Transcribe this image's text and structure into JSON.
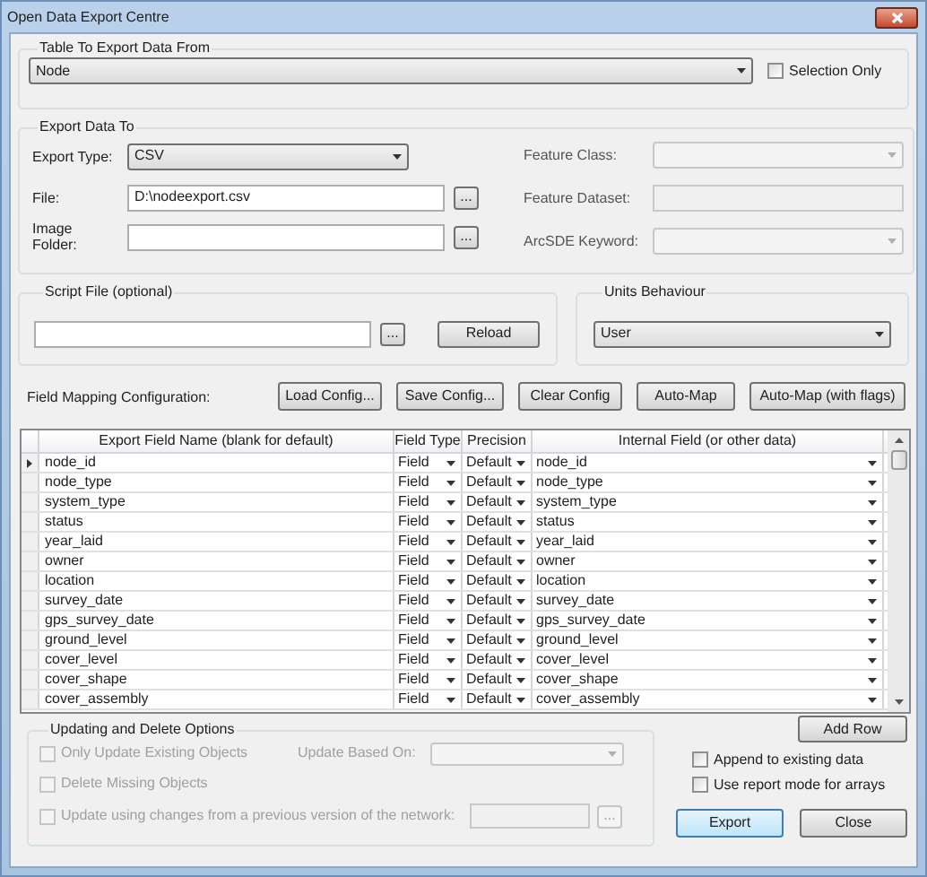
{
  "window": {
    "title": "Open Data Export Centre"
  },
  "source": {
    "legend": "Table To Export Data From",
    "table": "Node",
    "selection_only": {
      "label": "Selection Only",
      "checked": false
    }
  },
  "export_to": {
    "legend": "Export Data To",
    "export_type": {
      "label": "Export Type:",
      "value": "CSV"
    },
    "file": {
      "label": "File:",
      "value": "D:\\nodeexport.csv",
      "browse": "..."
    },
    "image_folder": {
      "label": "Image Folder:",
      "browse": "..."
    },
    "feature_class": {
      "label": "Feature Class:",
      "disabled": true
    },
    "feature_dataset": {
      "label": "Feature Dataset:",
      "disabled": true
    },
    "arcsde_keyword": {
      "label": "ArcSDE Keyword:",
      "disabled": true
    }
  },
  "script_file": {
    "legend": "Script File (optional)",
    "browse": "...",
    "reload": "Reload"
  },
  "units": {
    "legend": "Units Behaviour",
    "value": "User"
  },
  "mapping": {
    "label": "Field Mapping Configuration:",
    "buttons": [
      "Load Config...",
      "Save Config...",
      "Clear Config",
      "Auto-Map",
      "Auto-Map (with flags)"
    ]
  },
  "grid": {
    "columns": [
      "Export Field Name (blank for default)",
      "Field Type",
      "Precision",
      "Internal Field (or other data)"
    ],
    "rows": [
      {
        "selected": true,
        "export_name": "node_id",
        "field_type": "Field",
        "precision": "Default",
        "internal": "node_id"
      },
      {
        "selected": false,
        "export_name": "node_type",
        "field_type": "Field",
        "precision": "Default",
        "internal": "node_type"
      },
      {
        "selected": false,
        "export_name": "system_type",
        "field_type": "Field",
        "precision": "Default",
        "internal": "system_type"
      },
      {
        "selected": false,
        "export_name": "status",
        "field_type": "Field",
        "precision": "Default",
        "internal": "status"
      },
      {
        "selected": false,
        "export_name": "year_laid",
        "field_type": "Field",
        "precision": "Default",
        "internal": "year_laid"
      },
      {
        "selected": false,
        "export_name": "owner",
        "field_type": "Field",
        "precision": "Default",
        "internal": "owner"
      },
      {
        "selected": false,
        "export_name": "location",
        "field_type": "Field",
        "precision": "Default",
        "internal": "location"
      },
      {
        "selected": false,
        "export_name": "survey_date",
        "field_type": "Field",
        "precision": "Default",
        "internal": "survey_date"
      },
      {
        "selected": false,
        "export_name": "gps_survey_date",
        "field_type": "Field",
        "precision": "Default",
        "internal": "gps_survey_date"
      },
      {
        "selected": false,
        "export_name": "ground_level",
        "field_type": "Field",
        "precision": "Default",
        "internal": "ground_level"
      },
      {
        "selected": false,
        "export_name": "cover_level",
        "field_type": "Field",
        "precision": "Default",
        "internal": "cover_level"
      },
      {
        "selected": false,
        "export_name": "cover_shape",
        "field_type": "Field",
        "precision": "Default",
        "internal": "cover_shape"
      },
      {
        "selected": false,
        "export_name": "cover_assembly",
        "field_type": "Field",
        "precision": "Default",
        "internal": "cover_assembly"
      }
    ]
  },
  "add_row": "Add Row",
  "update_options": {
    "legend": "Updating and Delete Options",
    "disabled": true,
    "only_update": {
      "label": "Only Update Existing Objects",
      "checked": false
    },
    "update_based_on": {
      "label": "Update Based On:"
    },
    "delete_missing": {
      "label": "Delete Missing Objects",
      "checked": false
    },
    "update_changes": {
      "label": "Update using changes from a previous version of the network:",
      "checked": false
    },
    "browse": "..."
  },
  "options": [
    {
      "label": "Append to existing data",
      "checked": false
    },
    {
      "label": "Use report mode for arrays",
      "checked": false
    }
  ],
  "buttons": [
    {
      "label": "Export",
      "focused": true
    },
    {
      "label": "Close",
      "focused": false
    }
  ]
}
